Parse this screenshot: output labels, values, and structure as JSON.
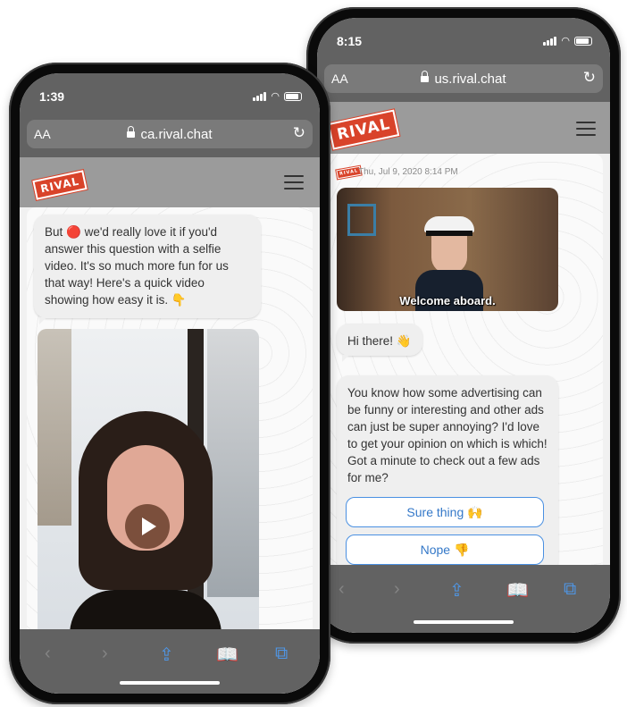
{
  "phone_right": {
    "status_time": "8:15",
    "url_aa": "AA",
    "url": "us.rival.chat",
    "logo_text": "RIVAL",
    "timestamp": "Thu, Jul 9, 2020 8:14 PM",
    "gif_caption": "Welcome aboard.",
    "greeting": "Hi there! 👋",
    "message": "You know how some advertising can be funny or interesting and other ads can just be super annoying? I'd love to get your opinion on which is which!  Got a minute to check out a few ads for me?",
    "choices": [
      "Sure thing 🙌",
      "Nope 👎"
    ]
  },
  "phone_left": {
    "status_time": "1:39",
    "url_aa": "AA",
    "url": "ca.rival.chat",
    "logo_text": "RIVAL",
    "message": "But 🔴 we'd really love it if you'd answer this question with a selfie video. It's so much more fun for us that way! Here's a quick video showing how easy it is. 👇"
  },
  "toolbar_icons": [
    "back-icon",
    "forward-icon",
    "share-icon",
    "bookmarks-icon",
    "tabs-icon"
  ],
  "colors": {
    "brand": "#d9432a",
    "link": "#4a90e2",
    "chrome": "#626262"
  }
}
